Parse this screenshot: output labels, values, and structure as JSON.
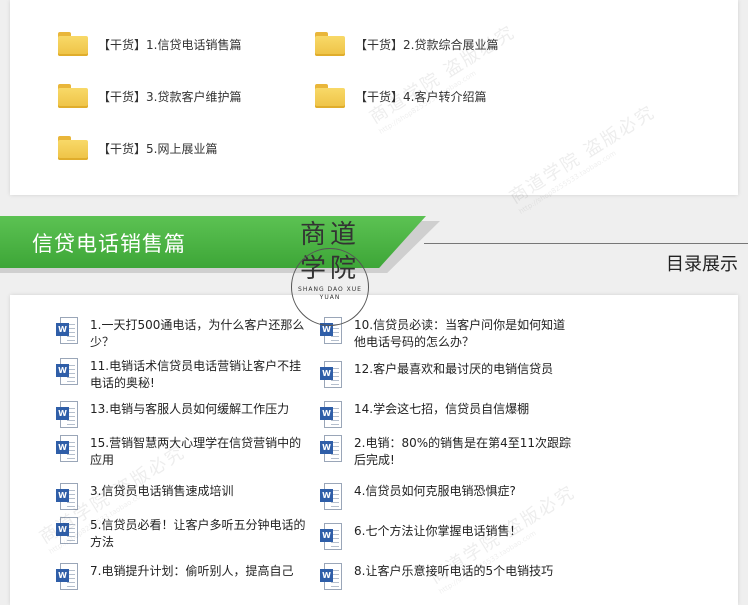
{
  "folders": [
    {
      "label": "【干货】1.信贷电话销售篇"
    },
    {
      "label": "【干货】2.贷款综合展业篇"
    },
    {
      "label": "【干货】3.贷款客户维护篇"
    },
    {
      "label": "【干货】4.客户转介绍篇"
    },
    {
      "label": "【干货】5.网上展业篇"
    }
  ],
  "banner": {
    "title": "信贷电话销售篇"
  },
  "section": {
    "label": "目录展示"
  },
  "seal": {
    "chars": "商道学院",
    "pinyin": "SHANG DAO XUE YUAN"
  },
  "documents": [
    {
      "label": "1.一天打500通电话，为什么客户还那么少？"
    },
    {
      "label": "10.信贷员必读：当客户问你是如何知道 他电话号码的怎么办？"
    },
    {
      "label": "11.电销话术信贷员电话营销让客户不挂电话的奥秘!"
    },
    {
      "label": "12.客户最喜欢和最讨厌的电销信贷员"
    },
    {
      "label": "13.电销与客服人员如何缓解工作压力"
    },
    {
      "label": "14.学会这七招，信贷员自信爆棚"
    },
    {
      "label": "15.营销智慧两大心理学在信贷营销中的应用"
    },
    {
      "label": "2.电销：80%的销售是在第4至11次跟踪后完成!"
    },
    {
      "label": "3.信贷员电话销售速成培训"
    },
    {
      "label": "4.信贷员如何克服电销恐惧症?"
    },
    {
      "label": "5.信贷员必看！让客户多听五分钟电话的方法"
    },
    {
      "label": "6.七个方法让你掌握电话销售！"
    },
    {
      "label": "7.电销提升计划：偷听别人，提高自己"
    },
    {
      "label": "8.让客户乐意接听电话的5个电销技巧"
    }
  ],
  "watermark": {
    "text": "商道学院 盗版必究",
    "url": "http://shop8255533.taobao.com"
  },
  "colors": {
    "banner": "#4cb544",
    "folder": "#f5cf56",
    "word_badge": "#2f5ea8"
  }
}
